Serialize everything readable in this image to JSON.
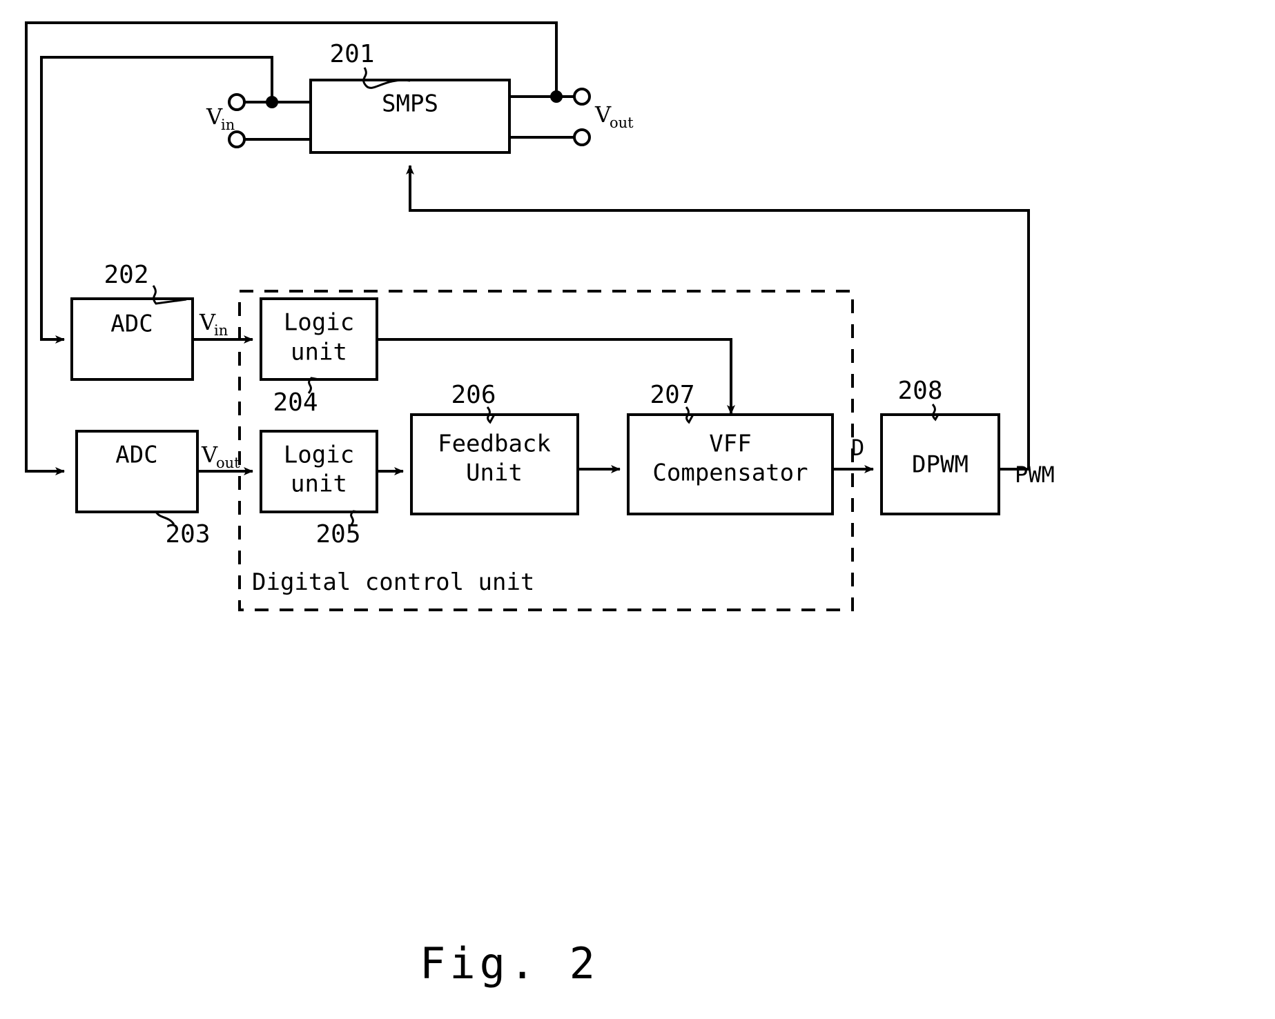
{
  "figure": {
    "caption": "Fig. 2",
    "caption_prefix": "Fig.",
    "caption_number": "2"
  },
  "blocks": [
    {
      "id": "smps",
      "label": "SMPS",
      "ref": "201"
    },
    {
      "id": "adc_vin",
      "label": "ADC",
      "ref": "202"
    },
    {
      "id": "adc_vout",
      "label": "ADC",
      "ref": "203"
    },
    {
      "id": "logic_vin",
      "label_line1": "Logic",
      "label_line2": "unit",
      "ref": "204"
    },
    {
      "id": "logic_vout",
      "label_line1": "Logic",
      "label_line2": "unit",
      "ref": "205"
    },
    {
      "id": "feedback",
      "label_line1": "Feedback",
      "label_line2": "Unit",
      "ref": "206"
    },
    {
      "id": "vff",
      "label_line1": "VFF",
      "label_line2": "Compensator",
      "ref": "207"
    },
    {
      "id": "dpwm",
      "label": "DPWM",
      "ref": "208"
    }
  ],
  "region": {
    "digital_control_unit_label": "Digital control unit"
  },
  "terminals": {
    "vin_main": "V",
    "vin_sub": "in",
    "vout_main": "V",
    "vout_sub": "out"
  },
  "signals": {
    "vin_bus_main": "V",
    "vin_bus_sub": "in",
    "vout_bus_main": "V",
    "vout_bus_sub": "out",
    "duty": "D",
    "pwm": "PWM"
  },
  "colors": {
    "ink": "#000000",
    "paper": "#ffffff"
  }
}
